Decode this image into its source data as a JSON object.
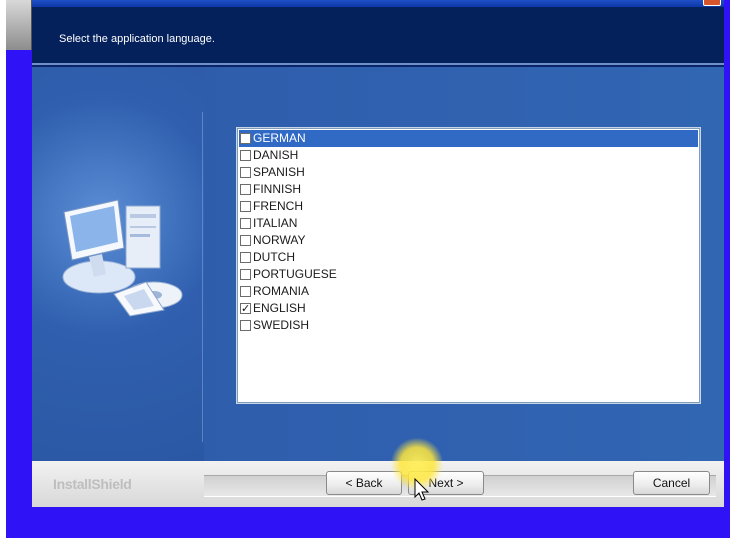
{
  "header": {
    "instruction": "Select the application language."
  },
  "languages": [
    {
      "label": "GERMAN",
      "checked": false,
      "selected": true
    },
    {
      "label": "DANISH",
      "checked": false,
      "selected": false
    },
    {
      "label": "SPANISH",
      "checked": false,
      "selected": false
    },
    {
      "label": "FINNISH",
      "checked": false,
      "selected": false
    },
    {
      "label": "FRENCH",
      "checked": false,
      "selected": false
    },
    {
      "label": "ITALIAN",
      "checked": false,
      "selected": false
    },
    {
      "label": "NORWAY",
      "checked": false,
      "selected": false
    },
    {
      "label": "DUTCH",
      "checked": false,
      "selected": false
    },
    {
      "label": "PORTUGUESE",
      "checked": false,
      "selected": false
    },
    {
      "label": "ROMANIA",
      "checked": false,
      "selected": false
    },
    {
      "label": "ENGLISH",
      "checked": true,
      "selected": false
    },
    {
      "label": "SWEDISH",
      "checked": false,
      "selected": false
    }
  ],
  "footer": {
    "brand": "InstallShield",
    "back_label": "< Back",
    "next_label": "Next >",
    "cancel_label": "Cancel"
  },
  "colors": {
    "desktop": "#2f12f5",
    "header": "#04215c",
    "selection": "#316ac5",
    "cursor_highlight": "#ffe63c"
  }
}
